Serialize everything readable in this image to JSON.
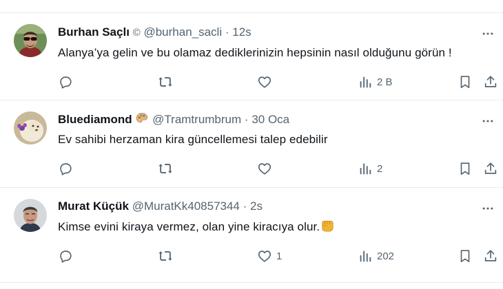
{
  "tweets": [
    {
      "name": "Burhan Saçlı",
      "badge": "©",
      "handle": "@burhan_sacli",
      "separator": "·",
      "time": "12s",
      "text": "Alanya’ya gelin ve bu olamaz dediklerinizin hepsinin nasıl  olduğunu görün !",
      "likes": "",
      "views": "2 B",
      "avatar_colors": {
        "bg": "#6d8f57",
        "skin": "#c99a7a",
        "shirt": "#8a2b2b"
      }
    },
    {
      "name": "Bluediamond",
      "emoji": "artist-palette",
      "handle": "@Tramtrumbrum",
      "separator": "·",
      "time": "30 Oca",
      "text": "Ev sahibi herzaman kira güncellemesi talep edebilir",
      "likes": "",
      "views": "2",
      "avatar_colors": {
        "bg": "#c9b99b",
        "fur": "#f2ead9",
        "flower": "#7a3fa0"
      }
    },
    {
      "name": "Murat Küçük",
      "handle": "@MuratKk40857344",
      "separator": "·",
      "time": "2s",
      "text": "Kimse evini kiraya vermez, olan yine kiracıya olur.",
      "text_emoji": "oncoming-fist",
      "likes": "1",
      "views": "202",
      "avatar_colors": {
        "bg": "#d6d9dc",
        "skin": "#c69a82",
        "hair": "#3b3b3b"
      }
    }
  ],
  "colors": {
    "text": "#0f1419",
    "secondary": "#536471",
    "divider": "#e6ecf0"
  },
  "icons": [
    "reply-icon",
    "retweet-icon",
    "like-icon",
    "views-icon",
    "bookmark-icon",
    "share-icon",
    "more-icon"
  ]
}
